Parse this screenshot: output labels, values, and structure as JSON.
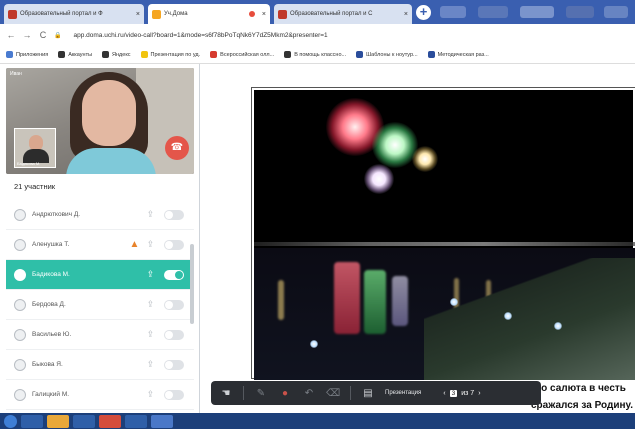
{
  "browser": {
    "tabs": [
      {
        "title": "Образовательный портал и Ф",
        "active": false
      },
      {
        "title": "Уч.Дома",
        "active": true
      },
      {
        "title": "Образовательный портал и С",
        "active": false
      }
    ],
    "url": "app.doma.uchi.ru/video-call?board=1&mode=s6f78bPoTqNk6Y7dZ5Mkm2&presenter=1",
    "bookmarks": [
      "Приложения",
      "Аккаунты",
      "Яндекс",
      "Презентация по уд.",
      "Всероссийская олл...",
      "В помощь классно...",
      "Шаблоны к ноутур...",
      "Методическая раз..."
    ]
  },
  "video": {
    "self_label": "Иван",
    "pip_label": "Бадикова М."
  },
  "participants": {
    "title": "21 участник",
    "items": [
      {
        "name": "Андрюткович Д.",
        "active": false,
        "warning": false
      },
      {
        "name": "Аленушка Т.",
        "active": false,
        "warning": true
      },
      {
        "name": "Бадикова М.",
        "active": true,
        "warning": false
      },
      {
        "name": "Бердова Д.",
        "active": false,
        "warning": false
      },
      {
        "name": "Васильев Ю.",
        "active": false,
        "warning": false
      },
      {
        "name": "Быкова Я.",
        "active": false,
        "warning": false
      },
      {
        "name": "Галицкий М.",
        "active": false,
        "warning": false
      }
    ]
  },
  "slide": {
    "caption_line1": "ого салюта в честь",
    "caption_line2": "сражался за Родину."
  },
  "toolbar": {
    "presentation_label": "Презентация",
    "page": "3",
    "page_total": "из 7"
  },
  "colors": {
    "accent": "#2fbfa8",
    "hangup": "#e4564a",
    "browser_blue": "#3a5fb0",
    "toolbar_bg": "#2b2e33"
  }
}
